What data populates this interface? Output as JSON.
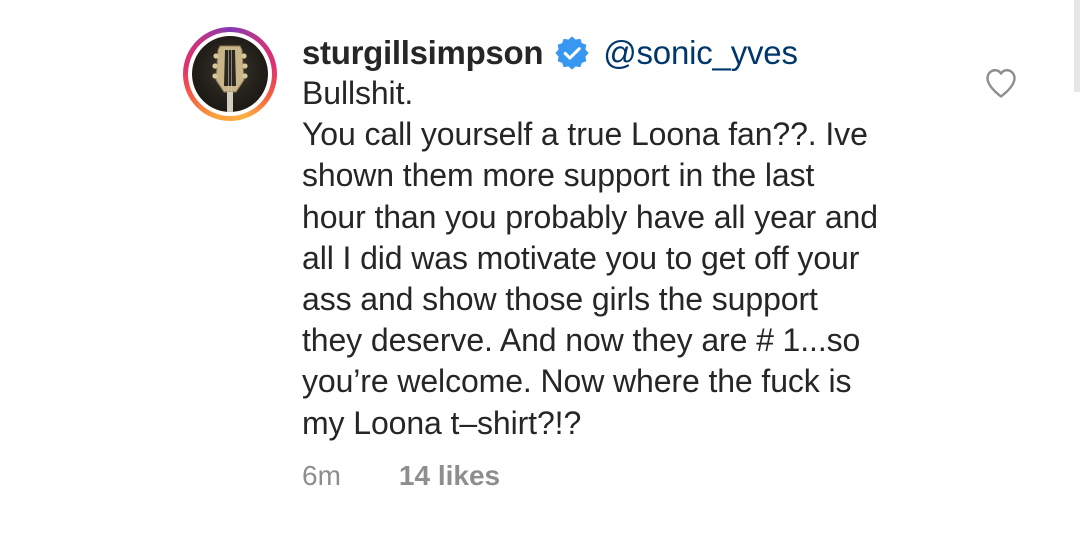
{
  "comment": {
    "username": "sturgillsimpson",
    "verified_icon": "verified-badge-icon",
    "mention": "@sonic_yves",
    "body": "Bullshit.\nYou call yourself a true Loona fan??. Ive\nshown them more support in the last\nhour than you probably have all year and\nall I did was motivate you to get off your\nass and show those girls the support\nthey deserve. And now they are # 1...so\nyou’re welcome. Now where the fuck is\nmy Loona t–shirt?!?",
    "time": "6m",
    "likes": "14 likes",
    "like_icon": "heart-icon"
  },
  "colors": {
    "text": "#262626",
    "mention": "#00376b",
    "muted": "#8e8e8e",
    "verified": "#3897f0"
  }
}
